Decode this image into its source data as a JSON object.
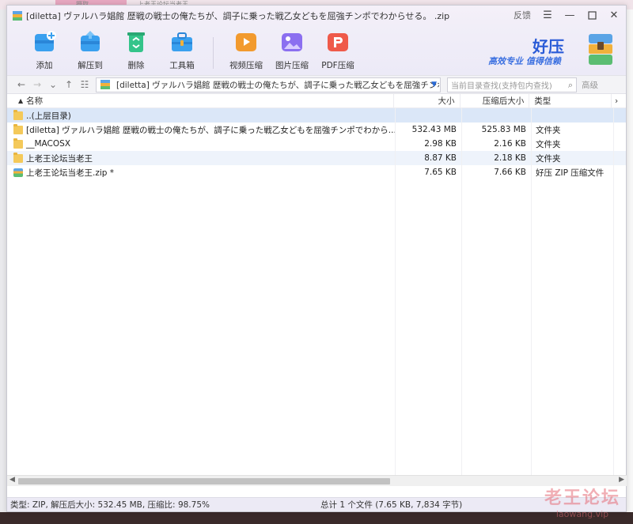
{
  "window": {
    "title": "[diletta] ヴァルハラ娼館 歴戦の戦士の俺たちが、調子に乗った戦乙女どもを屈強チンポでわからせる。 .zip",
    "feedback": "反馈",
    "menu_icon": "menu-icon",
    "minimize_icon": "minimize-icon",
    "maximize_icon": "maximize-icon",
    "close_icon": "close-icon"
  },
  "background": {
    "tab_label": "摄取",
    "tab_label2": "上老王论坛当老王"
  },
  "toolbar": {
    "items": [
      {
        "label": "添加",
        "icon": "add-archive-icon",
        "color": "#3aa0ef"
      },
      {
        "label": "解压到",
        "icon": "extract-icon",
        "color": "#3aa0ef"
      },
      {
        "label": "删除",
        "icon": "recycle-icon",
        "color": "#34c48a"
      },
      {
        "label": "工具箱",
        "icon": "toolbox-icon",
        "color": "#3aa0ef"
      },
      {
        "label": "视频压缩",
        "icon": "video-compress-icon",
        "color": "#f29a2e"
      },
      {
        "label": "图片压缩",
        "icon": "image-compress-icon",
        "color": "#8b6ff0"
      },
      {
        "label": "PDF压缩",
        "icon": "pdf-compress-icon",
        "color": "#ef5a4a"
      }
    ],
    "brand": {
      "name": "好压",
      "slogan": "高效专业  值得信赖"
    }
  },
  "address": {
    "path": "[diletta] ヴァルハラ娼館 歴戦の戦士の俺たちが、調子に乗った戦乙女どもを屈強チンポ",
    "search_placeholder": "当前目录查找(支持包内查找)",
    "advanced": "高级"
  },
  "columns": {
    "name": "名称",
    "size": "大小",
    "compressed": "压缩后大小",
    "type": "类型",
    "more": "›"
  },
  "rows": [
    {
      "name": "..(上层目录)",
      "size": "",
      "compressed": "",
      "type": "",
      "icon": "folder",
      "state": "sel"
    },
    {
      "name": "[diletta] ヴァルハラ娼館 歴戦の戦士の俺たちが、調子に乗った戦乙女どもを屈強チンポでわから...",
      "size": "532.43 MB",
      "compressed": "525.83 MB",
      "type": "文件夹",
      "icon": "folder",
      "state": ""
    },
    {
      "name": "__MACOSX",
      "size": "2.98 KB",
      "compressed": "2.16 KB",
      "type": "文件夹",
      "icon": "folder",
      "state": ""
    },
    {
      "name": "上老王论坛当老王",
      "size": "8.87 KB",
      "compressed": "2.18 KB",
      "type": "文件夹",
      "icon": "folder",
      "state": "alt"
    },
    {
      "name": "上老王论坛当老王.zip *",
      "size": "7.65 KB",
      "compressed": "7.66 KB",
      "type": "好压 ZIP 压缩文件",
      "icon": "zip",
      "state": ""
    }
  ],
  "status": {
    "left": "类型: ZIP, 解压后大小: 532.45 MB, 压缩比: 98.75%",
    "right": "总计 1 个文件 (7.65 KB, 7,834 字节)"
  },
  "watermark": {
    "line1": "老王论坛",
    "line2": "laowang.vip"
  }
}
